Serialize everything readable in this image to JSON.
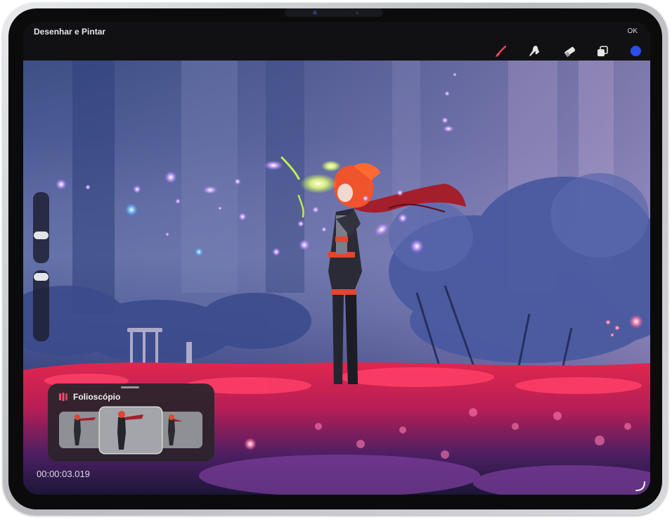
{
  "app": {
    "title": "Desenhar e Pintar",
    "done_label": "OK"
  },
  "toolbar": {
    "tools": [
      {
        "name": "brush-icon",
        "color": "#e8455c"
      },
      {
        "name": "smudge-icon",
        "color": "#e6e6e6"
      },
      {
        "name": "eraser-icon",
        "color": "#e6e6e6"
      },
      {
        "name": "layers-icon",
        "color": "#e6e6e6"
      }
    ],
    "current_color": "#2a4fe8"
  },
  "side_sliders": {
    "brush_size_level": 0.91,
    "opacity_level": 0.95
  },
  "flipbook": {
    "title": "Folioscópio",
    "frames_count": 3,
    "selected_frame": 2
  },
  "timecode": "00:00:03.019"
}
